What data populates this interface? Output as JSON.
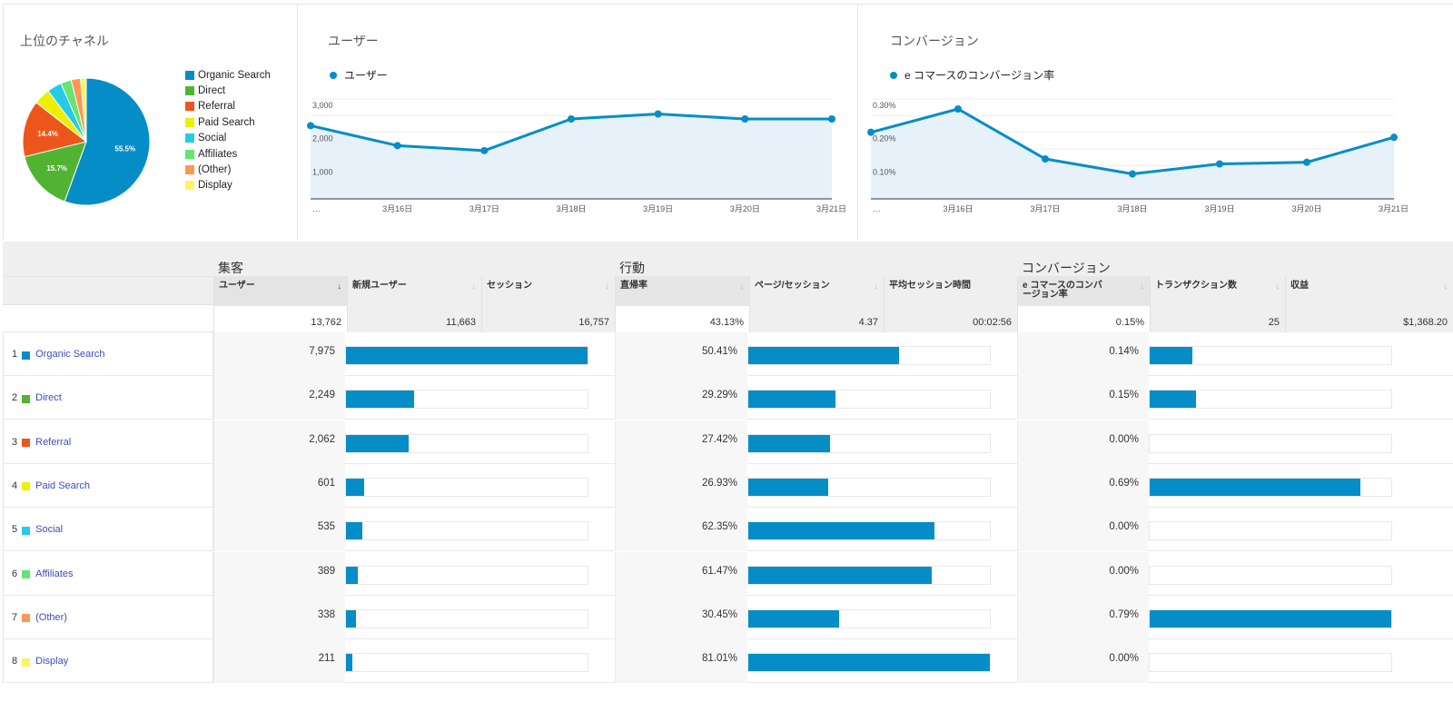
{
  "channels_panel": {
    "title": "上位のチャネル",
    "legend": [
      {
        "label": "Organic Search",
        "color": "#058dc7"
      },
      {
        "label": "Direct",
        "color": "#50b432"
      },
      {
        "label": "Referral",
        "color": "#ed561b"
      },
      {
        "label": "Paid Search",
        "color": "#edef00"
      },
      {
        "label": "Social",
        "color": "#24cbe5"
      },
      {
        "label": "Affiliates",
        "color": "#64e572"
      },
      {
        "label": "(Other)",
        "color": "#ff9655"
      },
      {
        "label": "Display",
        "color": "#fff263"
      }
    ]
  },
  "users_panel": {
    "title": "ユーザー",
    "series_label": "ユーザー"
  },
  "conversion_panel": {
    "title": "コンバージョン",
    "series_label": "e コマースのコンバージョン率"
  },
  "chart_data": [
    {
      "type": "pie",
      "title": "上位のチャネル",
      "categories": [
        "Organic Search",
        "Direct",
        "Referral",
        "Paid Search",
        "Social",
        "Affiliates",
        "(Other)",
        "Display"
      ],
      "values": [
        7975,
        2249,
        2062,
        601,
        535,
        389,
        338,
        211
      ],
      "data_labels": [
        "55.5%",
        "15.7%",
        "14.4%",
        "",
        "",
        "",
        "",
        ""
      ],
      "colors": [
        "#058dc7",
        "#50b432",
        "#ed561b",
        "#edef00",
        "#24cbe5",
        "#64e572",
        "#ff9655",
        "#fff263"
      ],
      "legend": "right"
    },
    {
      "type": "area",
      "title": "ユーザー",
      "x": [
        "…",
        "3月16日",
        "3月17日",
        "3月18日",
        "3月19日",
        "3月20日",
        "3月21日"
      ],
      "series": [
        {
          "name": "ユーザー",
          "values": [
            2200,
            1600,
            1450,
            2400,
            2550,
            2400,
            2400
          ]
        }
      ],
      "yticks": [
        "1,000",
        "2,000",
        "3,000"
      ],
      "ytick_values": [
        1000,
        2000,
        3000
      ],
      "ylim": [
        0,
        3000
      ],
      "grid": true,
      "legend": "top-left",
      "color": "#058dc7"
    },
    {
      "type": "area",
      "title": "コンバージョン",
      "x": [
        "…",
        "3月16日",
        "3月17日",
        "3月18日",
        "3月19日",
        "3月20日",
        "3月21日"
      ],
      "series": [
        {
          "name": "e コマースのコンバージョン率",
          "values": [
            0.2,
            0.27,
            0.12,
            0.075,
            0.105,
            0.11,
            0.185
          ]
        }
      ],
      "yticks": [
        "0.10%",
        "0.20%",
        "0.30%"
      ],
      "ytick_values": [
        0.1,
        0.2,
        0.3
      ],
      "ylim": [
        0,
        0.3
      ],
      "grid": true,
      "legend": "top-left",
      "color": "#058dc7"
    }
  ],
  "table": {
    "groups": [
      {
        "label": "集客"
      },
      {
        "label": "行動"
      },
      {
        "label": "コンバージョン"
      }
    ],
    "columns": [
      {
        "label": "ユーザー",
        "sort": "↓",
        "total": "13,762"
      },
      {
        "label": "新規ユーザー",
        "sort": "↓",
        "total": "11,663"
      },
      {
        "label": "セッション",
        "sort": "↓",
        "total": "16,757"
      },
      {
        "label": "直帰率",
        "sort": "↓",
        "total": "43.13%"
      },
      {
        "label": "ページ/セッション",
        "sort": "↓",
        "total": "4.37"
      },
      {
        "label": "平均セッション時間",
        "sort": "",
        "total": "00:02:56"
      },
      {
        "label": "e コマースのコンバージョン率",
        "sort": "↓",
        "total": "0.15%"
      },
      {
        "label": "トランザクション数",
        "sort": "↓",
        "total": "25"
      },
      {
        "label": "収益",
        "sort": "↓",
        "total": "$1,368.20"
      }
    ],
    "rows": [
      {
        "index": "1",
        "channel": "Organic Search",
        "color": "#058dc7",
        "users": "7,975",
        "users_frac": 1.0,
        "bounce": "50.41%",
        "bounce_frac": 0.6223,
        "conv": "0.14%",
        "conv_frac": 0.1772
      },
      {
        "index": "2",
        "channel": "Direct",
        "color": "#50b432",
        "users": "2,249",
        "users_frac": 0.282,
        "bounce": "29.29%",
        "bounce_frac": 0.3616,
        "conv": "0.15%",
        "conv_frac": 0.1899
      },
      {
        "index": "3",
        "channel": "Referral",
        "color": "#ed561b",
        "users": "2,062",
        "users_frac": 0.2586,
        "bounce": "27.42%",
        "bounce_frac": 0.3385,
        "conv": "0.00%",
        "conv_frac": 0
      },
      {
        "index": "4",
        "channel": "Paid Search",
        "color": "#edef00",
        "users": "601",
        "users_frac": 0.0754,
        "bounce": "26.93%",
        "bounce_frac": 0.3324,
        "conv": "0.69%",
        "conv_frac": 0.8734
      },
      {
        "index": "5",
        "channel": "Social",
        "color": "#24cbe5",
        "users": "535",
        "users_frac": 0.0671,
        "bounce": "62.35%",
        "bounce_frac": 0.7697,
        "conv": "0.00%",
        "conv_frac": 0
      },
      {
        "index": "6",
        "channel": "Affiliates",
        "color": "#64e572",
        "users": "389",
        "users_frac": 0.0488,
        "bounce": "61.47%",
        "bounce_frac": 0.7588,
        "conv": "0.00%",
        "conv_frac": 0
      },
      {
        "index": "7",
        "channel": "(Other)",
        "color": "#ff9655",
        "users": "338",
        "users_frac": 0.0424,
        "bounce": "30.45%",
        "bounce_frac": 0.3759,
        "conv": "0.79%",
        "conv_frac": 1.0
      },
      {
        "index": "8",
        "channel": "Display",
        "color": "#fff263",
        "users": "211",
        "users_frac": 0.0265,
        "bounce": "81.01%",
        "bounce_frac": 1.0,
        "conv": "0.00%",
        "conv_frac": 0
      }
    ]
  }
}
